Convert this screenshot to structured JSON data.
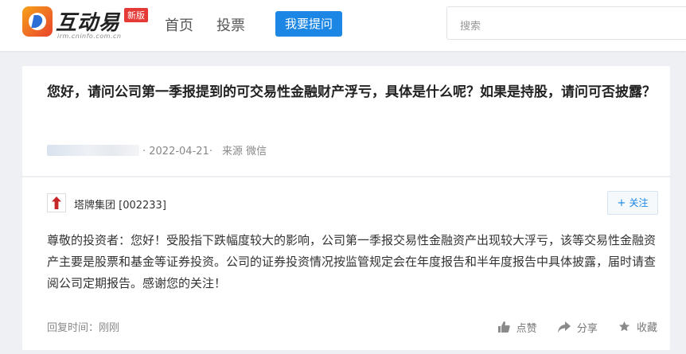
{
  "header": {
    "logo_text": "互动易",
    "logo_sub": "irm.cninfo.com.cn",
    "logo_badge": "新版",
    "nav_home": "首页",
    "nav_vote": "投票",
    "ask_button": "我要提问",
    "search_placeholder": "搜索"
  },
  "question": {
    "title": "您好，请问公司第一季报提到的可交易性金融财产浮亏，具体是什么呢？如果是持股，请问可否披露？",
    "date": "· 2022-04-21·",
    "source": "来源 微信"
  },
  "answer": {
    "company": "塔牌集团 [002233]",
    "follow_label": "关注",
    "follow_plus": "+",
    "text": "尊敬的投资者：您好！受股指下跌幅度较大的影响，公司第一季报交易性金融资产出现较大浮亏，该等交易性金融资产主要是股票和基金等证券投资。公司的证券投资情况按监管规定会在年度报告和半年度报告中具体披露，届时请查阅公司定期报告。感谢您的关注！",
    "reply_time": "回复时间：刚刚",
    "like_label": "点赞",
    "share_label": "分享",
    "collect_label": "收藏"
  },
  "icons": {
    "logo": "interaction-logo-icon",
    "company_logo": "company-logo-icon",
    "like": "thumbs-up-icon",
    "share": "share-arrow-icon",
    "collect": "star-icon"
  },
  "colors": {
    "accent": "#1b86e4",
    "badge": "#e53935",
    "background": "#eef0f3"
  }
}
